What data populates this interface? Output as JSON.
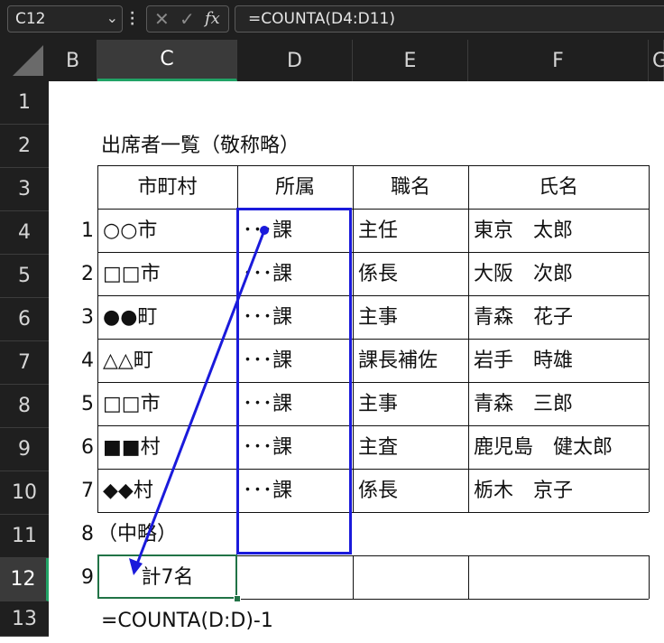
{
  "formula_bar": {
    "name_box": "C12",
    "formula": "=COUNTA(D4:D11)",
    "fx_icon": "fx-icon",
    "cancel_icon": "cancel-x-icon",
    "enter_icon": "enter-check-icon"
  },
  "columns": [
    "B",
    "C",
    "D",
    "E",
    "F",
    "G"
  ],
  "selected_column": "C",
  "rows": [
    "1",
    "2",
    "3",
    "4",
    "5",
    "6",
    "7",
    "8",
    "9",
    "10",
    "11",
    "12",
    "13"
  ],
  "selected_row": "12",
  "sheet": {
    "title": "出席者一覧（敬称略）",
    "headers": [
      "市町村",
      "所属",
      "職名",
      "氏名"
    ],
    "data_rows": [
      {
        "no": "1",
        "city": "○○市",
        "dept": "･･･課",
        "title": "主任",
        "name": "東京　太郎"
      },
      {
        "no": "2",
        "city": "□□市",
        "dept": "･･･課",
        "title": "係長",
        "name": "大阪　次郎"
      },
      {
        "no": "3",
        "city": "●●町",
        "dept": "･･･課",
        "title": "主事",
        "name": "青森　花子"
      },
      {
        "no": "4",
        "city": "△△町",
        "dept": "･･･課",
        "title": "課長補佐",
        "name": "岩手　時雄"
      },
      {
        "no": "5",
        "city": "□□市",
        "dept": "･･･課",
        "title": "主事",
        "name": "青森　三郎"
      },
      {
        "no": "6",
        "city": "■■村",
        "dept": "･･･課",
        "title": "主査",
        "name": "鹿児島　健太郎"
      },
      {
        "no": "7",
        "city": "◆◆村",
        "dept": "･･･課",
        "title": "係長",
        "name": "栃木　京子"
      }
    ],
    "row11": {
      "no": "8",
      "city": "（中略）"
    },
    "row12": {
      "no": "9",
      "total": "計7名"
    },
    "row13_note": "=COUNTA(D:D)-1"
  },
  "colors": {
    "highlight_box": "#1a1adb",
    "arrow": "#1a1adb",
    "selection": "#21a366"
  }
}
